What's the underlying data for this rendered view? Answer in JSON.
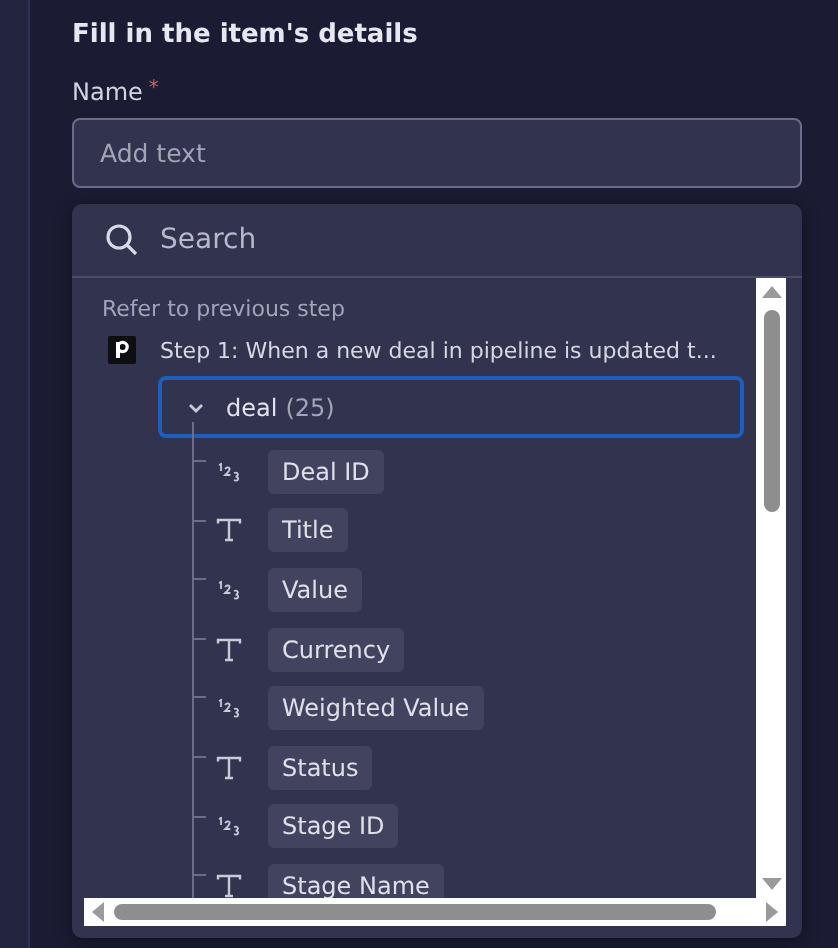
{
  "form": {
    "title": "Fill in the item's details",
    "field_label": "Name",
    "required_mark": "*",
    "placeholder": "Add text"
  },
  "picker": {
    "search_placeholder": "Search",
    "section_label": "Refer to previous step",
    "step": {
      "label": "Step 1: When a new deal in pipeline is updated t..."
    },
    "group": {
      "name": "deal",
      "count": "(25)",
      "expanded": true,
      "selected": true,
      "children": [
        {
          "kind": "number",
          "label": "Deal ID"
        },
        {
          "kind": "text",
          "label": "Title"
        },
        {
          "kind": "number",
          "label": "Value"
        },
        {
          "kind": "text",
          "label": "Currency"
        },
        {
          "kind": "number",
          "label": "Weighted Value"
        },
        {
          "kind": "text",
          "label": "Status"
        },
        {
          "kind": "number",
          "label": "Stage ID"
        },
        {
          "kind": "text",
          "label": "Stage Name"
        }
      ]
    }
  }
}
